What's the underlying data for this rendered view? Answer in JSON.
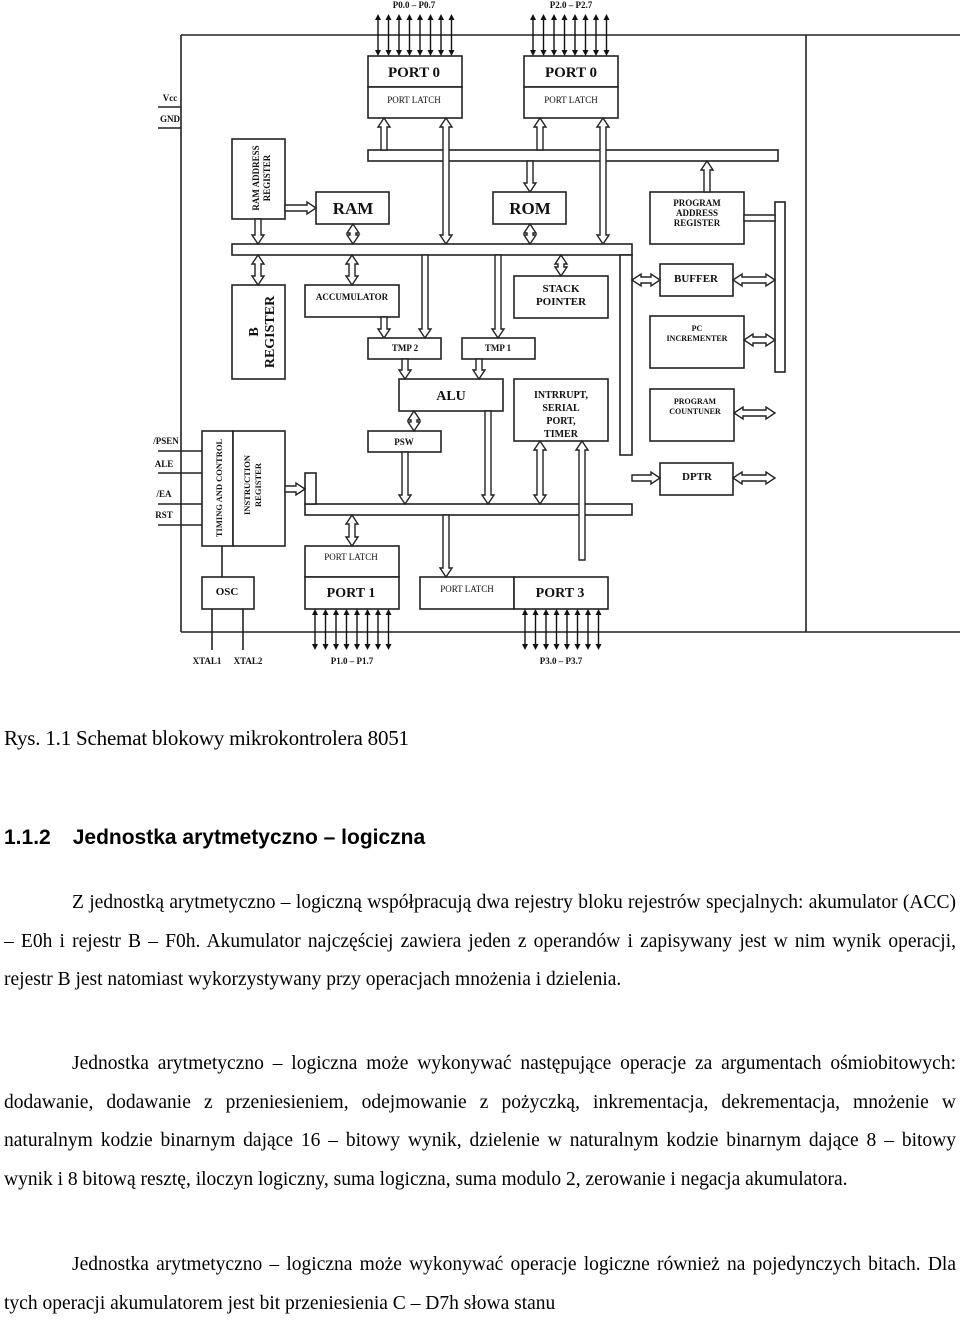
{
  "figure": {
    "pins_top": {
      "port0_pins": "P0.0 – P0.7",
      "port2_pins": "P2.0 – P2.7"
    },
    "power": {
      "vcc": "Vcc",
      "gnd": "GND"
    },
    "blocks": {
      "port0_top": {
        "title": "PORT 0",
        "latch": "PORT LATCH"
      },
      "port2_top": {
        "title": "PORT 0",
        "latch": "PORT LATCH"
      },
      "ram_address_register": {
        "line1": "RAM ADDRESS",
        "line2": "REGISTER"
      },
      "ram": "RAM",
      "rom": "ROM",
      "program_address_register": {
        "line1": "PROGRAM",
        "line2": "ADDRESS",
        "line3": "REGISTER"
      },
      "b_register": {
        "line1": "B",
        "line2": "REGISTER"
      },
      "accumulator": "ACCUMULATOR",
      "tmp2": "TMP 2",
      "tmp1": "TMP 1",
      "stack_pointer": {
        "line1": "STACK",
        "line2": "POINTER"
      },
      "buffer": "BUFFER",
      "pc_incrementer": {
        "line1": "PC",
        "line2": "INCREMENTER"
      },
      "alu": "ALU",
      "interrupt": {
        "line1": "INTRRUPT,",
        "line2": "SERIAL",
        "line3": "PORT,",
        "line4": "TIMER"
      },
      "program_counter": {
        "line1": "PROGRAM",
        "line2": "COUNTUNER"
      },
      "psw": "PSW",
      "dptr": "DPTR",
      "timing_control": "TIMING AND CONTROL",
      "instruction_register": {
        "line1": "INSTRUCTION",
        "line2": "REGISTER"
      },
      "osc": "OSC",
      "port1": {
        "title": "PORT 1",
        "latch": "PORT LATCH"
      },
      "port3": {
        "title": "PORT 3",
        "latch": "PORT LATCH"
      }
    },
    "control_pins": {
      "psen": "/PSEN",
      "ale": "ALE",
      "ea": "/EA",
      "rst": "RST"
    },
    "pins_bottom": {
      "xtal1": "XTAL1",
      "xtal2": "XTAL2",
      "port1_pins": "P1.0 – P1.7",
      "port3_pins": "P3.0 – P3.7"
    }
  },
  "document": {
    "caption": "Rys. 1.1 Schemat blokowy mikrokontrolera 8051",
    "section_number": "1.1.2",
    "section_title": "Jednostka arytmetyczno – logiczna",
    "paragraphs": [
      "Z jednostką arytmetyczno – logiczną współpracują dwa rejestry bloku rejestrów specjalnych: akumulator (ACC) – E0h i rejestr B – F0h. Akumulator najczęściej zawiera jeden z operandów i zapisywany jest w nim wynik operacji, rejestr B jest natomiast wykorzystywany przy operacjach mnożenia i dzielenia.",
      "Jednostka arytmetyczno – logiczna może wykonywać następujące operacje za argumentach ośmiobitowych: dodawanie, dodawanie z przeniesieniem, odejmowanie z pożyczką, inkrementacja, dekrementacja, mnożenie w naturalnym kodzie binarnym dające 16 – bitowy wynik, dzielenie w naturalnym kodzie binarnym dające 8 – bitowy wynik i 8 bitową resztę, iloczyn logiczny, suma logiczna, suma modulo 2, zerowanie i negacja akumulatora.",
      "Jednostka arytmetyczno – logiczna może wykonywać operacje logiczne również na pojedynczych bitach. Dla tych operacji akumulatorem jest bit przeniesienia C – D7h słowa stanu"
    ]
  }
}
